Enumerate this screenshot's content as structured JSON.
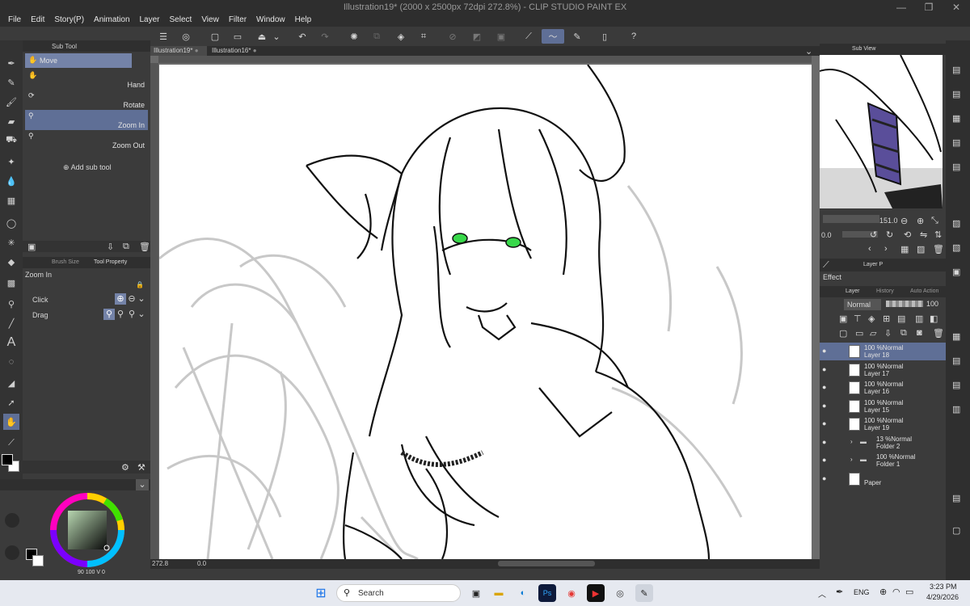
{
  "window": {
    "title": "Illustration19* (2000 x 2500px 72dpi 272.8%) - CLIP STUDIO PAINT EX"
  },
  "menu": [
    "File",
    "Edit",
    "Story(P)",
    "Animation",
    "Layer",
    "Select",
    "View",
    "Filter",
    "Window",
    "Help"
  ],
  "subtool": {
    "tab_label": "Sub Tool",
    "group": "Move",
    "items": [
      {
        "label": "Hand"
      },
      {
        "label": "Rotate"
      },
      {
        "label": "Zoom In"
      },
      {
        "label": "Zoom Out"
      }
    ],
    "add": "Add sub tool"
  },
  "toolprop": {
    "tabs": [
      "Brush Size",
      "Tool Property"
    ],
    "title": "Zoom In",
    "rows": [
      {
        "label": "Click"
      },
      {
        "label": "Drag"
      }
    ]
  },
  "color": {
    "fg": "#000000",
    "bg": "#ffffff",
    "status": "90 100 V 0"
  },
  "tabs": [
    {
      "label": "Illustration19*"
    },
    {
      "label": "Illustration16*"
    }
  ],
  "status": {
    "zoom": "272.8",
    "angle": "0.0"
  },
  "navigator": {
    "tab": "Sub View",
    "zoom": "151.0",
    "rotation": "0.0"
  },
  "layers": {
    "top_tabs": [
      "Layer P"
    ],
    "effect_label": "Effect",
    "tabs": [
      "Layer",
      "History",
      "Auto Action"
    ],
    "blend": "Normal",
    "opacity": "100",
    "list": [
      {
        "name": "Layer 18",
        "pct": "100 %Normal",
        "selected": true
      },
      {
        "name": "Layer 17",
        "pct": "100 %Normal"
      },
      {
        "name": "Layer 16",
        "pct": "100 %Normal"
      },
      {
        "name": "Layer 15",
        "pct": "100 %Normal"
      },
      {
        "name": "Layer 19",
        "pct": "100 %Normal"
      },
      {
        "name": "Folder 2",
        "pct": "13 %Normal",
        "folder": true
      },
      {
        "name": "Folder 1",
        "pct": "100 %Normal",
        "folder": true
      },
      {
        "name": "Paper",
        "pct": "",
        "paper": true
      }
    ]
  },
  "taskbar": {
    "search": "Search",
    "lang": "ENG",
    "time": "3:23 PM",
    "date": "4/29/2026"
  }
}
